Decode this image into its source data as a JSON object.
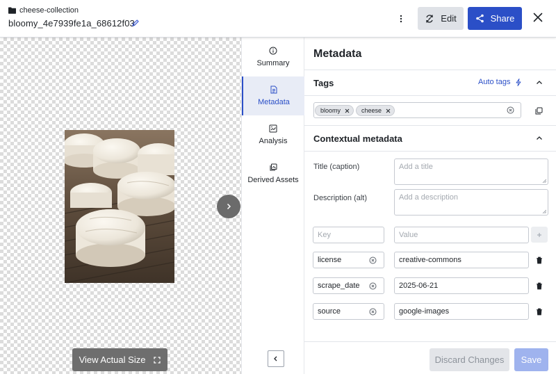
{
  "header": {
    "collection": "cheese-collection",
    "file_name": "bloomy_4e7939fe1a_68612f03",
    "edit_label": "Edit",
    "share_label": "Share",
    "accent": "#2b4fc7"
  },
  "preview": {
    "view_actual_label": "View Actual Size"
  },
  "sidenav": {
    "items": [
      {
        "label": "Summary",
        "icon": "info-icon"
      },
      {
        "label": "Metadata",
        "icon": "document-icon",
        "active": true
      },
      {
        "label": "Analysis",
        "icon": "analysis-icon"
      },
      {
        "label": "Derived Assets",
        "icon": "stack-icon"
      }
    ]
  },
  "metadata": {
    "title": "Metadata",
    "tags_section": "Tags",
    "auto_tags_label": "Auto tags",
    "tags": [
      "bloomy",
      "cheese"
    ],
    "contextual_section": "Contextual metadata",
    "caption_label": "Title (caption)",
    "caption_placeholder": "Add a title",
    "alt_label": "Description (alt)",
    "alt_placeholder": "Add a description",
    "key_placeholder": "Key",
    "value_placeholder": "Value",
    "pairs": [
      {
        "key": "license",
        "value": "creative-commons"
      },
      {
        "key": "scrape_date",
        "value": "2025-06-21"
      },
      {
        "key": "source",
        "value": "google-images"
      }
    ],
    "discard_label": "Discard Changes",
    "save_label": "Save"
  }
}
